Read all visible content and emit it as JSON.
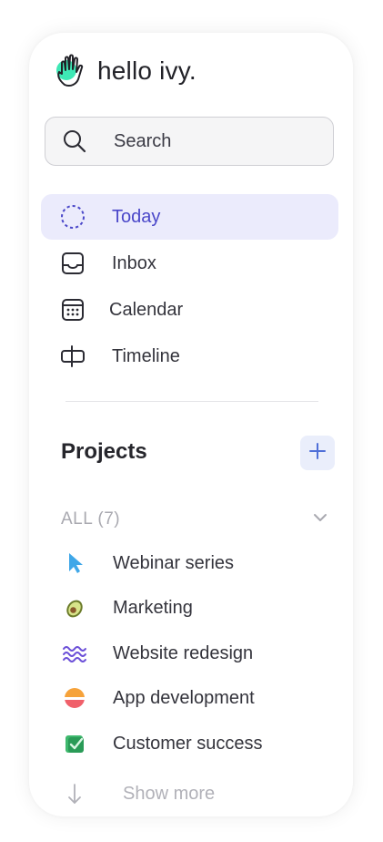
{
  "brand": {
    "name": "hello ivy.",
    "accent": "#3ee8b5"
  },
  "search": {
    "label": "Search"
  },
  "nav": {
    "items": [
      {
        "label": "Today",
        "icon": "dashed-circle-icon",
        "active": true
      },
      {
        "label": "Inbox",
        "icon": "inbox-icon",
        "active": false
      },
      {
        "label": "Calendar",
        "icon": "calendar-icon",
        "active": false
      },
      {
        "label": "Timeline",
        "icon": "timeline-icon",
        "active": false
      }
    ],
    "active_color": "#4a47c9",
    "active_bg": "#ebebfc"
  },
  "projects": {
    "title": "Projects",
    "add_icon": "plus-icon",
    "filter_label": "ALL (7)",
    "items": [
      {
        "label": "Webinar series",
        "icon": "cursor-arrow-icon"
      },
      {
        "label": "Marketing",
        "icon": "avocado-icon"
      },
      {
        "label": "Website redesign",
        "icon": "wavy-lines-icon"
      },
      {
        "label": "App development",
        "icon": "sunset-circle-icon"
      },
      {
        "label": "Customer success",
        "icon": "green-check-box-icon"
      }
    ],
    "show_more": "Show more"
  }
}
